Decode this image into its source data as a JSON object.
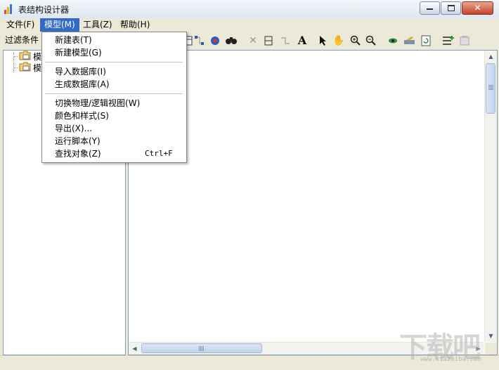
{
  "window": {
    "title": "表结构设计器"
  },
  "menubar": {
    "items": [
      {
        "label": "文件(F)"
      },
      {
        "label": "模型(M)"
      },
      {
        "label": "工具(Z)"
      },
      {
        "label": "帮助(H)"
      }
    ],
    "active_index": 1
  },
  "model_menu": {
    "items": [
      {
        "label": "新建表(T)",
        "shortcut": ""
      },
      {
        "label": "新建模型(G)",
        "shortcut": ""
      },
      {
        "label": "导入数据库(I)",
        "shortcut": ""
      },
      {
        "label": "生成数据库(A)",
        "shortcut": ""
      },
      {
        "label": "切换物理/逻辑视图(W)",
        "shortcut": ""
      },
      {
        "label": "颜色和样式(S)",
        "shortcut": ""
      },
      {
        "label": "导出(X)...",
        "shortcut": ""
      },
      {
        "label": "运行脚本(Y)",
        "shortcut": ""
      },
      {
        "label": "查找对象(Z)",
        "shortcut": "Ctrl+F"
      }
    ]
  },
  "left_panel": {
    "filter_label": "过滤条件",
    "tree": [
      {
        "label": "模"
      },
      {
        "label": "模"
      }
    ]
  },
  "toolbar": {
    "icons": [
      "table-icon",
      "relation-icon",
      "model-icon",
      "find-icon",
      "delete-icon",
      "column-icon",
      "link-icon",
      "text-icon",
      "pointer-icon",
      "hand-icon",
      "zoom-in-icon",
      "zoom-out-icon",
      "eye-icon",
      "edit-icon",
      "refresh-icon",
      "add-field-icon",
      "properties-icon"
    ]
  },
  "watermark": {
    "text": "下载吧",
    "url": "www.xiazaiba.com"
  },
  "colors": {
    "menu_highlight": "#316ac5",
    "panel_border": "#7f9db9",
    "chrome": "#ece9d8"
  }
}
